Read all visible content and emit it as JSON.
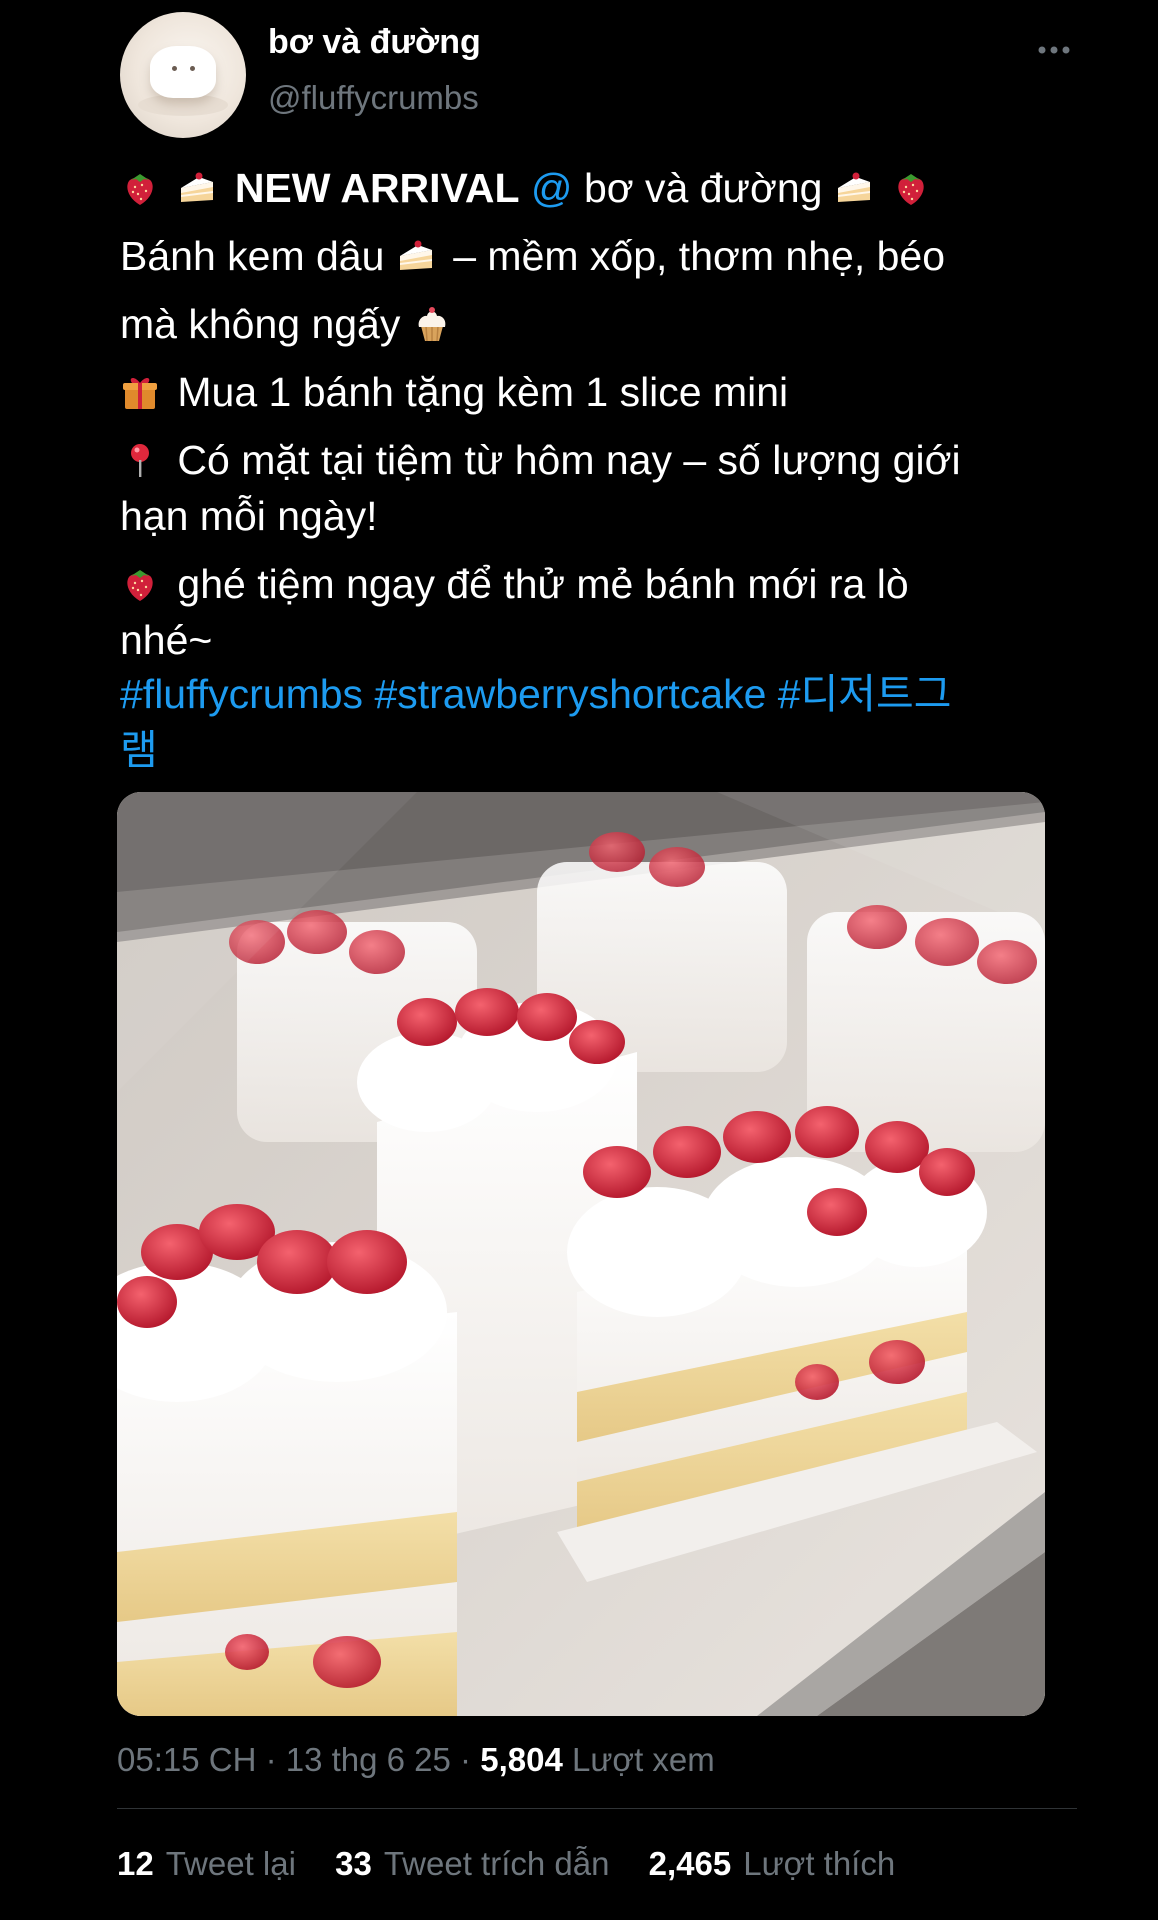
{
  "author": {
    "display_name": "bơ và đường",
    "handle": "@fluffycrumbs",
    "avatar_icon": "cream-character-avatar"
  },
  "menu": {
    "icon": "more-dots-icon"
  },
  "tweet": {
    "line1": {
      "label": "NEW ARRIVAL",
      "at": "@",
      "name": "bơ và đường"
    },
    "line2a": "Bánh kem dâu",
    "line2b": "– mềm xốp, thơm nhẹ, béo",
    "line3": "mà không ngấy",
    "line4": "Mua 1 bánh tặng kèm 1 slice mini",
    "line5a": "Có mặt tại tiệm từ hôm nay – số lượng giới",
    "line5b": "hạn mỗi ngày!",
    "line6a": "ghé tiệm ngay để thử mẻ bánh mới ra lò",
    "line6b": "nhé~",
    "hashtags_line1": "#fluffycrumbs #strawberryshortcake #디저트그",
    "hashtags_line2": "램"
  },
  "emoji_icons": [
    "strawberry-icon",
    "cake-slice-icon",
    "cupcake-icon",
    "gift-icon",
    "pin-icon"
  ],
  "media": {
    "alt": "strawberry shortcake slices in display case"
  },
  "meta": {
    "timestamp": "05:15 CH · 13 thg 6 25 ·",
    "views_count": "5,804",
    "views_label": "Lượt xem"
  },
  "stats": {
    "retweets_count": "12",
    "retweets_label": "Tweet lại",
    "quotes_count": "33",
    "quotes_label": "Tweet trích dẫn",
    "likes_count": "2,465",
    "likes_label": "Lượt thích"
  },
  "colors": {
    "background": "#000000",
    "text": "#ffffff",
    "secondary": "#6e767d",
    "link": "#1d9bf0",
    "divider": "#2f3336"
  }
}
